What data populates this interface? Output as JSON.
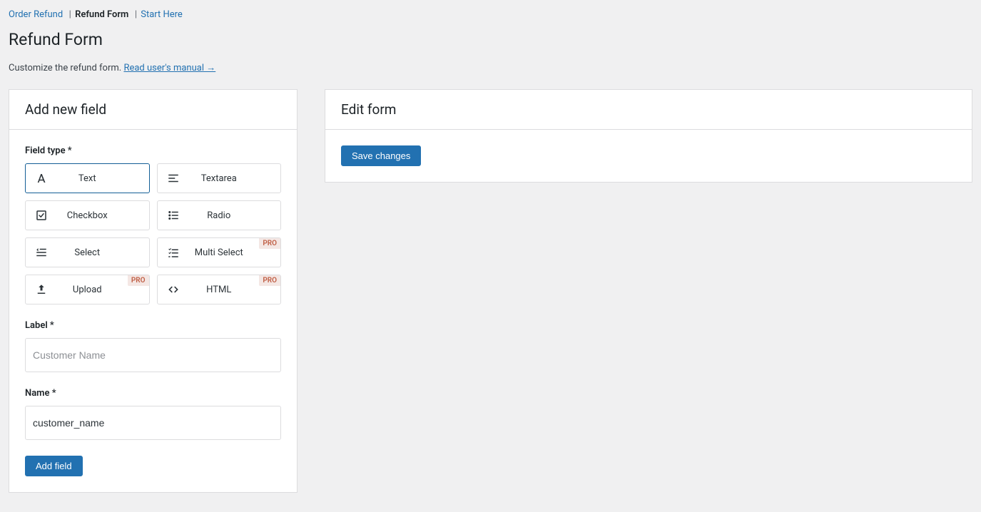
{
  "tabs": {
    "order_refund": "Order Refund",
    "refund_form": "Refund Form",
    "start_here": "Start Here"
  },
  "page_title": "Refund Form",
  "subtitle_text": "Customize the refund form. ",
  "subtitle_link": "Read user's manual →",
  "add_panel": {
    "title": "Add new field",
    "field_type_label": "Field type *",
    "types": {
      "text": "Text",
      "textarea": "Textarea",
      "checkbox": "Checkbox",
      "radio": "Radio",
      "select": "Select",
      "multi_select": "Multi Select",
      "upload": "Upload",
      "html": "HTML"
    },
    "pro_badge": "PRO",
    "label_label": "Label *",
    "label_placeholder": "Customer Name",
    "name_label": "Name *",
    "name_value": "customer_name",
    "add_button": "Add field"
  },
  "edit_panel": {
    "title": "Edit form",
    "save_button": "Save changes"
  }
}
